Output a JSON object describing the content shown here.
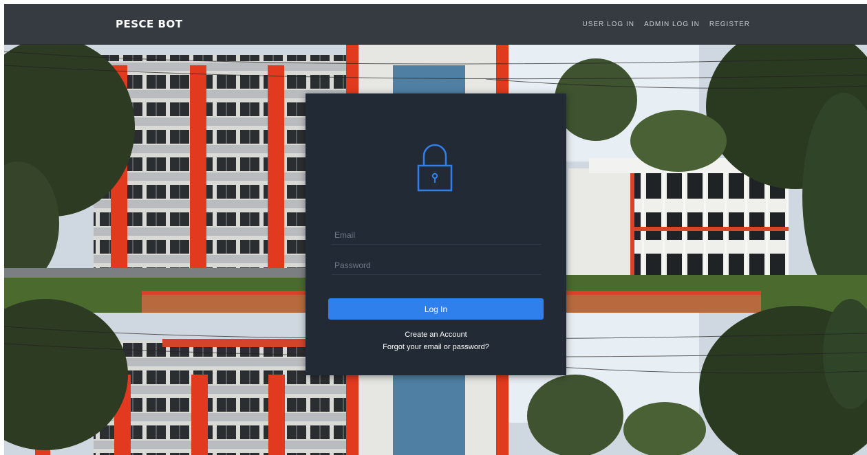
{
  "navbar": {
    "brand": "PESCE BOT",
    "links": [
      {
        "label": "USER LOG IN"
      },
      {
        "label": "ADMIN LOG IN"
      },
      {
        "label": "REGISTER"
      }
    ]
  },
  "login": {
    "icon": "lock-icon",
    "email_placeholder": "Email",
    "password_placeholder": "Password",
    "button_label": "Log In",
    "create_account": "Create an Account",
    "forgot": "Forgot your email or password?"
  },
  "colors": {
    "navbar": "#363b42",
    "card": "#222a35",
    "accent": "#2f80ed",
    "building_red": "#e23a1f"
  }
}
